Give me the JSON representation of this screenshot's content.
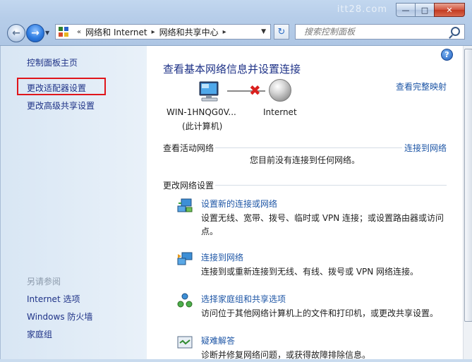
{
  "window": {
    "watermark": "itt28.com",
    "buttons": {
      "minimize": "—",
      "maximize": "□",
      "close": "✕"
    }
  },
  "nav": {
    "back_icon": "arrow-left-icon",
    "forward_icon": "arrow-right-icon",
    "breadcrumb_sep": "«",
    "crumbs": [
      "网络和 Internet",
      "网络和共享中心"
    ],
    "refresh_glyph": "↻",
    "search_placeholder": "搜索控制面板"
  },
  "sidebar": {
    "items": [
      "控制面板主页",
      "更改适配器设置",
      "更改高级共享设置"
    ],
    "see_also_heading": "另请参阅",
    "see_also": [
      "Internet 选项",
      "Windows 防火墙",
      "家庭组"
    ]
  },
  "main": {
    "title": "查看基本网络信息并设置连接",
    "full_map_link": "查看完整映射",
    "map": {
      "computer_name": "WIN-1HNQG0V...",
      "computer_sub": "(此计算机)",
      "internet_label": "Internet"
    },
    "active_networks": {
      "heading": "查看活动网络",
      "connect_link": "连接到网络",
      "status": "您目前没有连接到任何网络。"
    },
    "change_settings": {
      "heading": "更改网络设置",
      "tasks": [
        {
          "title": "设置新的连接或网络",
          "desc": "设置无线、宽带、拨号、临时或 VPN 连接；或设置路由器或访问点。"
        },
        {
          "title": "连接到网络",
          "desc": "连接到或重新连接到无线、有线、拨号或 VPN 网络连接。"
        },
        {
          "title": "选择家庭组和共享选项",
          "desc": "访问位于其他网络计算机上的文件和打印机，或更改共享设置。"
        },
        {
          "title": "疑难解答",
          "desc": "诊断并修复网络问题，或获得故障排除信息。"
        }
      ]
    }
  },
  "colors": {
    "link": "#1e56a6",
    "heading": "#1e3287",
    "highlight_box": "#e0151b"
  }
}
